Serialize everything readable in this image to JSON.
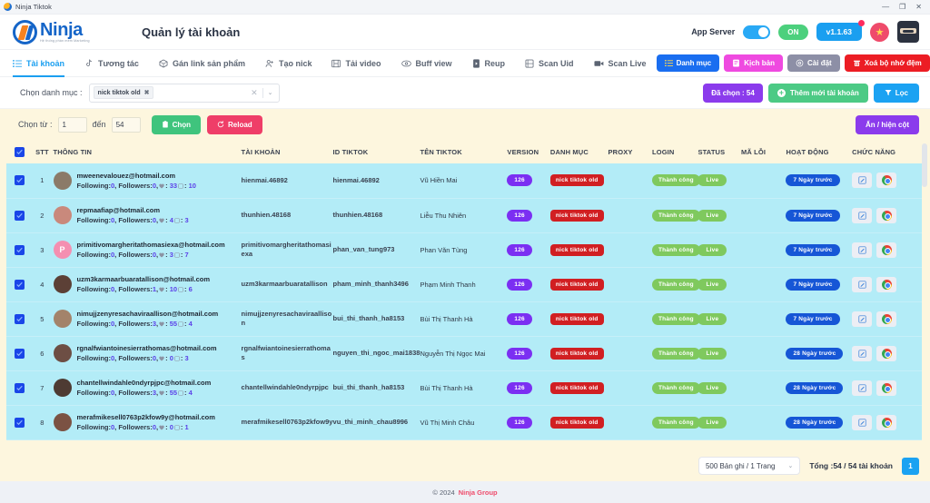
{
  "window": {
    "title": "Ninja Tiktok",
    "minimize": "—",
    "maximize": "❐",
    "close": "✕"
  },
  "header": {
    "brand_name": "Ninja",
    "brand_sub": "Hệ thống phần mềm Marketing",
    "page_title": "Quản lý tài khoản",
    "app_server_label": "App Server",
    "status_label": "ON",
    "version_label": "v1.1.63"
  },
  "tabs": [
    {
      "label": "Tài khoản",
      "icon": "list-icon",
      "active": true
    },
    {
      "label": "Tương tác",
      "icon": "tiktok-note-icon",
      "active": false
    },
    {
      "label": "Gán link sản phẩm",
      "icon": "box-icon",
      "active": false
    },
    {
      "label": "Tạo nick",
      "icon": "user-plus-icon",
      "active": false
    },
    {
      "label": "Tải video",
      "icon": "film-icon",
      "active": false
    },
    {
      "label": "Buff view",
      "icon": "eye-icon",
      "active": false
    },
    {
      "label": "Reup",
      "icon": "play-box-icon",
      "active": false
    },
    {
      "label": "Scan Uid",
      "icon": "scan-icon",
      "active": false
    },
    {
      "label": "Scan Live",
      "icon": "video-camera-icon",
      "active": false
    }
  ],
  "tab_actions": [
    {
      "label": "Danh mục",
      "icon": "list-icon",
      "color": "#1a6ef0"
    },
    {
      "label": "Kịch bản",
      "icon": "script-icon",
      "color": "#ef4ae0"
    },
    {
      "label": "Cài đặt",
      "icon": "gear-icon",
      "color": "#8d8fa6"
    },
    {
      "label": "Xoá bộ nhớ đệm",
      "icon": "trash-icon",
      "color": "#ec1d24"
    }
  ],
  "filter": {
    "category_label": "Chọn danh mục :",
    "selected_chip": "nick tiktok old",
    "chip_remove": "✖",
    "clear_icon": "✕",
    "caret_icon": "⌄",
    "selected_count_label": "Đã chọn : 54",
    "add_account_label": "Thêm mới tài khoản",
    "filter_label": "Lọc"
  },
  "range": {
    "from_label": "Chọn từ :",
    "from_value": "1",
    "to_label": "đến",
    "to_value": "54",
    "select_label": "Chọn",
    "reload_label": "Reload",
    "hide_columns_label": "Ẩn / hiện cột"
  },
  "table": {
    "columns": [
      "STT",
      "THÔNG TIN",
      "TÀI KHOẢN",
      "ID TIKTOK",
      "TÊN TIKTOK",
      "VERSION",
      "DANH MỤC",
      "PROXY",
      "LOGIN",
      "STATUS",
      "MÃ LỖI",
      "HOẠT ĐỘNG",
      "CHỨC NĂNG"
    ],
    "rows": [
      {
        "stt": "1",
        "email": "mweenevalouez@hotmail.com",
        "following": "0",
        "followers": "0",
        "hearts": "33",
        "videos": "10",
        "avatar_color": "#8b7a68",
        "avatar_letter": "",
        "account": "hienmai.46892",
        "id_tiktok": "hienmai.46892",
        "name_tiktok": "Vũ Hiền Mai",
        "version": "126",
        "category": "nick tiktok old",
        "proxy": "",
        "login": "Thành công",
        "status": "Live",
        "error": "",
        "activity": "7 Ngày trước"
      },
      {
        "stt": "2",
        "email": "repmaafiap@hotmail.com",
        "following": "0",
        "followers": "0",
        "hearts": "4",
        "videos": "3",
        "avatar_color": "#c9897c",
        "avatar_letter": "",
        "account": "thunhien.48168",
        "id_tiktok": "thunhien.48168",
        "name_tiktok": "Liễu Thu Nhiên",
        "version": "126",
        "category": "nick tiktok old",
        "proxy": "",
        "login": "Thành công",
        "status": "Live",
        "error": "",
        "activity": "7 Ngày trước"
      },
      {
        "stt": "3",
        "email": "primitivomargheritathomasiexa@hotmail.com",
        "following": "0",
        "followers": "0",
        "hearts": "3",
        "videos": "7",
        "avatar_color": "#f48fb1",
        "avatar_letter": "P",
        "account": "primitivomargheritathomasiexa",
        "id_tiktok": "phan_van_tung973",
        "name_tiktok": "Phan Văn Tùng",
        "version": "126",
        "category": "nick tiktok old",
        "proxy": "",
        "login": "Thành công",
        "status": "Live",
        "error": "",
        "activity": "7 Ngày trước"
      },
      {
        "stt": "4",
        "email": "uzm3karmaarbuaratallison@hotmail.com",
        "following": "0",
        "followers": "1",
        "hearts": "10",
        "videos": "6",
        "avatar_color": "#5c4036",
        "avatar_letter": "",
        "account": "uzm3karmaarbuaratallison",
        "id_tiktok": "pham_minh_thanh3496",
        "name_tiktok": "Phạm Minh Thanh",
        "version": "126",
        "category": "nick tiktok old",
        "proxy": "",
        "login": "Thành công",
        "status": "Live",
        "error": "",
        "activity": "7 Ngày trước"
      },
      {
        "stt": "5",
        "email": "nimujjzenyresachaviraallison@hotmail.com",
        "following": "0",
        "followers": "3",
        "hearts": "55",
        "videos": "4",
        "avatar_color": "#a3836a",
        "avatar_letter": "",
        "account": "nimujjzenyresachaviraallison",
        "id_tiktok": "bui_thi_thanh_ha8153",
        "name_tiktok": "Bùi Thị Thanh Hà",
        "version": "126",
        "category": "nick tiktok old",
        "proxy": "",
        "login": "Thành công",
        "status": "Live",
        "error": "",
        "activity": "7 Ngày trước"
      },
      {
        "stt": "6",
        "email": "rgnalfwiantoinesierrathomas@hotmail.com",
        "following": "0",
        "followers": "0",
        "hearts": "0",
        "videos": "3",
        "avatar_color": "#6d4e44",
        "avatar_letter": "",
        "account": "rgnalfwiantoinesierrathomas",
        "id_tiktok": "nguyen_thi_ngoc_mai1838",
        "name_tiktok": "Nguyễn Thị Ngọc Mai",
        "version": "126",
        "category": "nick tiktok old",
        "proxy": "",
        "login": "Thành công",
        "status": "Live",
        "error": "",
        "activity": "28 Ngày trước"
      },
      {
        "stt": "7",
        "email": "chantellwindahle0ndyrpjpc@hotmail.com",
        "following": "0",
        "followers": "3",
        "hearts": "55",
        "videos": "4",
        "avatar_color": "#4e3b33",
        "avatar_letter": "",
        "account": "chantellwindahle0ndyrpjpc",
        "id_tiktok": "bui_thi_thanh_ha8153",
        "name_tiktok": "Bùi Thị Thanh Hà",
        "version": "126",
        "category": "nick tiktok old",
        "proxy": "",
        "login": "Thành công",
        "status": "Live",
        "error": "",
        "activity": "28 Ngày trước"
      },
      {
        "stt": "8",
        "email": "merafmikesell0763p2kfow9y@hotmail.com",
        "following": "0",
        "followers": "0",
        "hearts": "0",
        "videos": "1",
        "avatar_color": "#7b5243",
        "avatar_letter": "",
        "account": "merafmikesell0763p2kfow9y",
        "id_tiktok": "vu_thi_minh_chau8996",
        "name_tiktok": "Vũ Thị Minh Châu",
        "version": "126",
        "category": "nick tiktok old",
        "proxy": "",
        "login": "Thành công",
        "status": "Live",
        "error": "",
        "activity": "28 Ngày trước"
      }
    ],
    "stats_prefix_following": "Following:",
    "stats_prefix_followers": ", Followers:",
    "stats_sep": ": ",
    "stats_sep2": ": "
  },
  "pagination": {
    "page_size_label": "500 Bản ghi / 1 Trang",
    "caret": "⌄",
    "total_label": "Tổng :54 / 54 tài khoản",
    "current_page": "1"
  },
  "footer": {
    "copyright": "© 2024",
    "brand": "Ninja Group"
  }
}
